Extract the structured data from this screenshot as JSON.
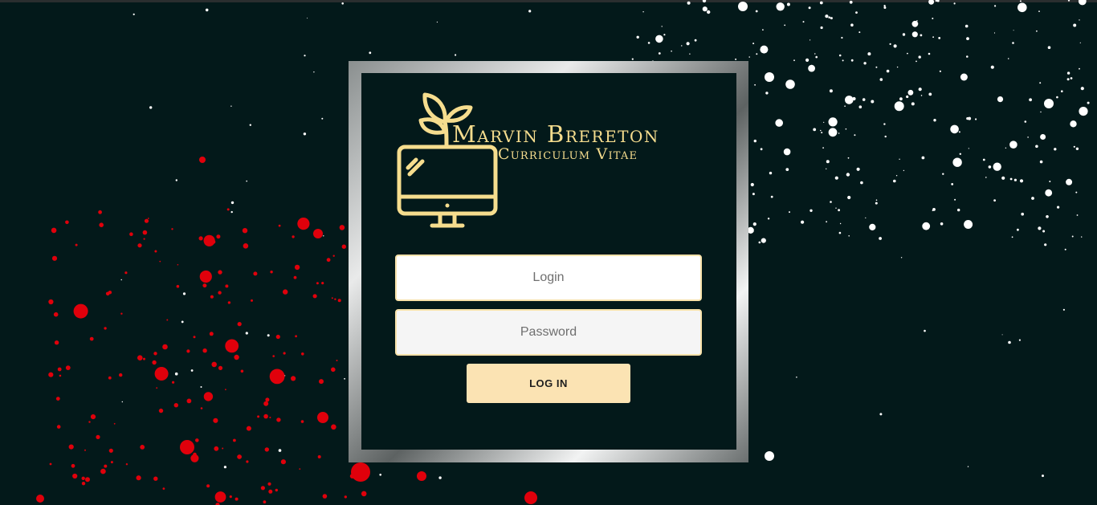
{
  "brand": {
    "name": "Marvin Brereton",
    "subtitle": "Curriculum Vitae"
  },
  "form": {
    "login_placeholder": "Login",
    "password_placeholder": "Password",
    "submit_label": "LOG IN"
  },
  "icons": {
    "logo": "computer-monitor-with-plant-sprout-icon"
  },
  "colors": {
    "background": "#03191a",
    "brand_gold": "#f6dd8e",
    "button": "#fbe3b3",
    "input_border": "#f8e2aa",
    "white_splatter": "#ffffff",
    "red_splatter": "#e0000b"
  }
}
